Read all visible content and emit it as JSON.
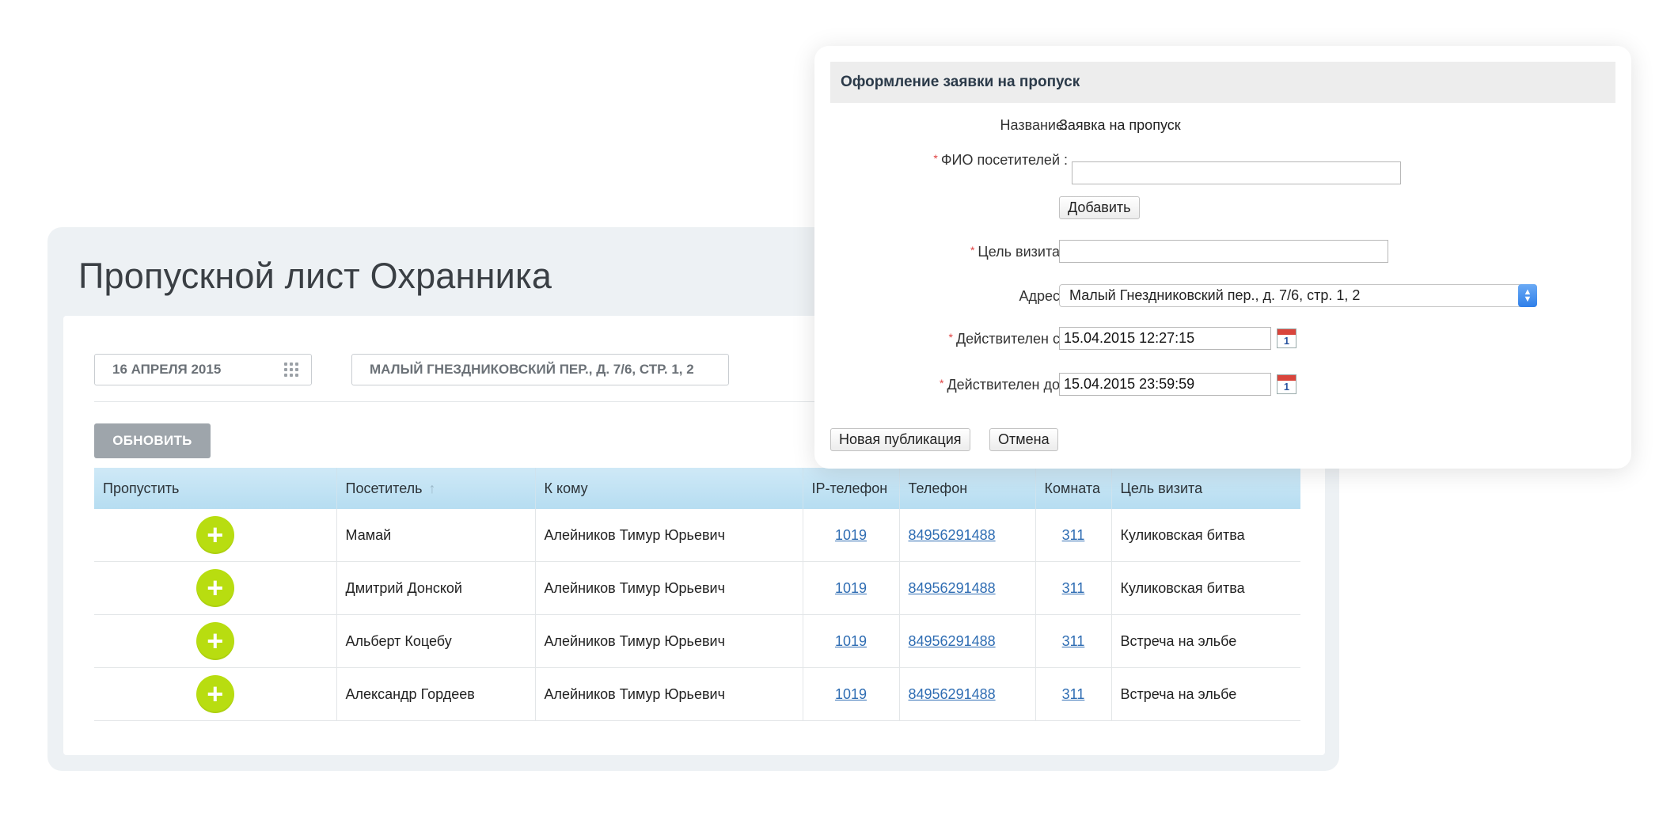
{
  "main": {
    "title": "Пропускной лист Охранника",
    "date_filter": "16 апреля 2015",
    "address_filter": "Малый Гнездниковский пер., д. 7/6, стр. 1, 2",
    "refresh_label": "Обновить",
    "columns": [
      "Пропустить",
      "Посетитель",
      "К кому",
      "IP-телефон",
      "Телефон",
      "Комната",
      "Цель визита"
    ],
    "rows": [
      {
        "visitor": "Мамай",
        "host": "Алейников Тимур Юрьевич",
        "ip_phone": "1019",
        "phone": "84956291488",
        "room": "311",
        "purpose": "Куликовская битва"
      },
      {
        "visitor": "Дмитрий Донской",
        "host": "Алейников Тимур Юрьевич",
        "ip_phone": "1019",
        "phone": "84956291488",
        "room": "311",
        "purpose": "Куликовская битва"
      },
      {
        "visitor": "Альберт Коцебу",
        "host": "Алейников Тимур Юрьевич",
        "ip_phone": "1019",
        "phone": "84956291488",
        "room": "311",
        "purpose": "Встреча на эльбе"
      },
      {
        "visitor": "Александр Гордеев",
        "host": "Алейников Тимур Юрьевич",
        "ip_phone": "1019",
        "phone": "84956291488",
        "room": "311",
        "purpose": "Встреча на эльбе"
      }
    ],
    "accent_color": "#b8dd10"
  },
  "dialog": {
    "title": "Оформление заявки на пропуск",
    "name_label": "Название:",
    "name_value": "Заявка на пропуск",
    "fio_label": "ФИО посетителей :",
    "fio_value": "",
    "add_label": "Добавить",
    "purpose_label": "Цель визита :",
    "purpose_value": "",
    "address_label": "Адрес :",
    "address_value": "Малый Гнездниковский пер., д. 7/6, стр. 1, 2",
    "valid_from_label": "Действителен с :",
    "valid_from_value": "15.04.2015 12:27:15",
    "valid_to_label": "Действителен до :",
    "valid_to_value": "15.04.2015 23:59:59",
    "calendar_day": "1",
    "new_pub_label": "Новая публикация",
    "cancel_label": "Отмена",
    "required_mark": "*"
  }
}
